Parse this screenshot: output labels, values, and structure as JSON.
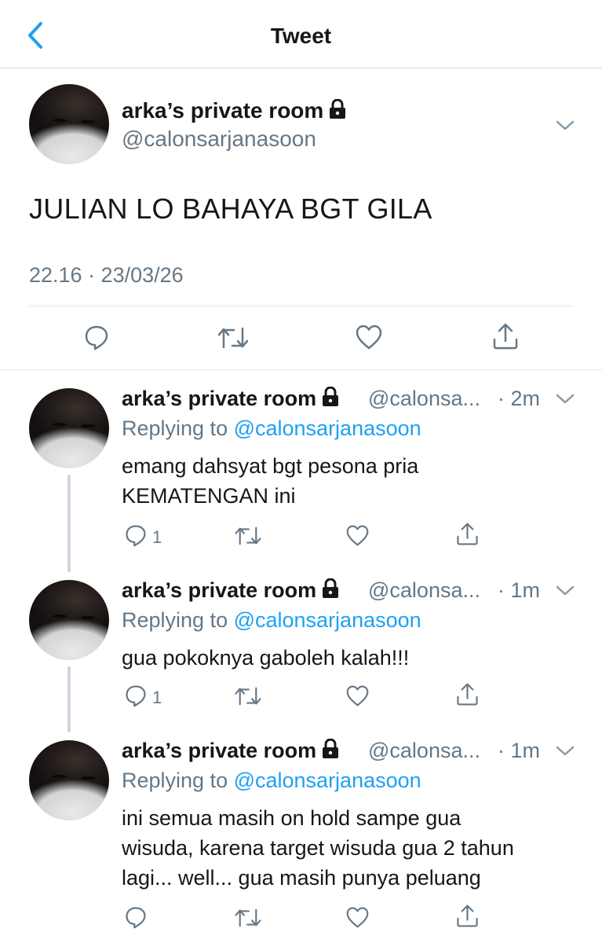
{
  "header": {
    "title": "Tweet",
    "back_icon": "chevron-left-icon",
    "accent": "#1da1f2"
  },
  "main_tweet": {
    "name": "arka’s private room",
    "handle": "@calonsarjanasoon",
    "text": "JULIAN LO BAHAYA BGT GILA",
    "timestamp": "22.16 · 23/03/26",
    "actions": [
      "reply-icon",
      "retweet-icon",
      "like-icon",
      "share-icon"
    ]
  },
  "replies": [
    {
      "name": "arka’s private room",
      "handle": "@calonsa...",
      "time": "· 2m",
      "replying_prefix": "Replying to ",
      "replying_handle": "@calonsarjanasoon",
      "text_lines": [
        "emang dahsyat bgt pesona pria",
        "KEMATENGAN ini"
      ],
      "reply_count": "1"
    },
    {
      "name": "arka’s private room",
      "handle": "@calonsa...",
      "time": "· 1m",
      "replying_prefix": "Replying to ",
      "replying_handle": "@calonsarjanasoon",
      "text_lines": [
        "gua pokoknya gaboleh kalah!!!"
      ],
      "reply_count": "1"
    },
    {
      "name": "arka’s private room",
      "handle": "@calonsa...",
      "time": "· 1m",
      "replying_prefix": "Replying to ",
      "replying_handle": "@calonsarjanasoon",
      "text_lines": [
        "ini semua masih on hold sampe gua",
        "wisuda, karena target wisuda gua 2 tahun",
        "lagi... well... gua masih punya peluang"
      ],
      "reply_count": ""
    }
  ]
}
